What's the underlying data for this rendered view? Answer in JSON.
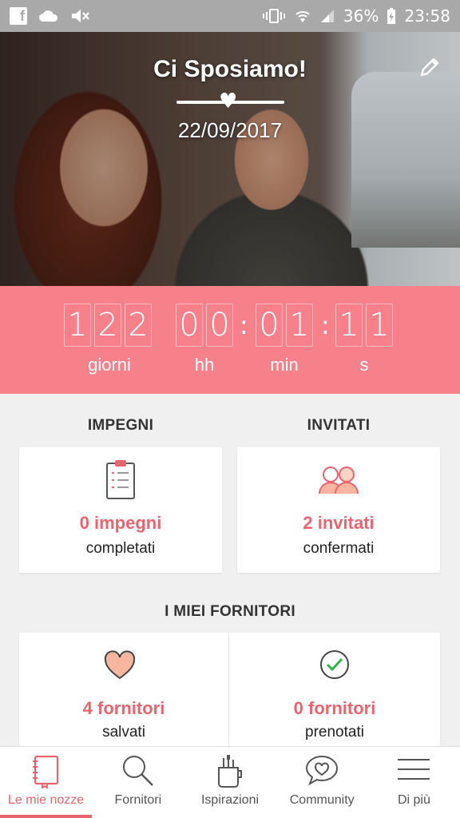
{
  "status_bar": {
    "battery": "36%",
    "time": "23:58"
  },
  "hero": {
    "title": "Ci Sposiamo!",
    "date": "22/09/2017"
  },
  "countdown": {
    "days": [
      "1",
      "2",
      "2"
    ],
    "hours": [
      "0",
      "0"
    ],
    "minutes": [
      "0",
      "1"
    ],
    "seconds": [
      "1",
      "1"
    ],
    "labels": {
      "days": "giorni",
      "hours": "hh",
      "minutes": "min",
      "seconds": "s"
    }
  },
  "tasks": {
    "title": "IMPEGNI",
    "value": "0 impegni",
    "caption": "completati"
  },
  "guests": {
    "title": "INVITATI",
    "value": "2 invitati",
    "caption": "confermati"
  },
  "vendors": {
    "title": "I MIEI FORNITORI",
    "saved_value": "4 fornitori",
    "saved_caption": "salvati",
    "booked_value": "0 fornitori",
    "booked_caption": "prenotati"
  },
  "nav": {
    "items": [
      {
        "label": "Le mie nozze",
        "icon": "notebook-icon",
        "active": true
      },
      {
        "label": "Fornitori",
        "icon": "search-icon",
        "active": false
      },
      {
        "label": "Ispirazioni",
        "icon": "brushes-cup-icon",
        "active": false
      },
      {
        "label": "Community",
        "icon": "heart-speech-bubble-icon",
        "active": false
      },
      {
        "label": "Di più",
        "icon": "menu-icon",
        "active": false
      }
    ]
  },
  "colors": {
    "accent": "#f7818a",
    "accent_text": "#e8646e",
    "status_bar": "#a9a9a9"
  }
}
